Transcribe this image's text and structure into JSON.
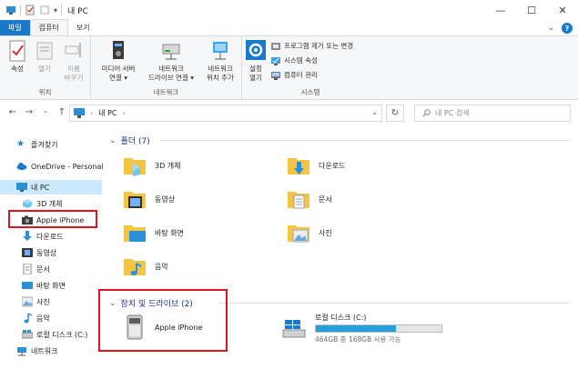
{
  "window": {
    "title": "내 PC",
    "controls": [
      "—",
      "☐",
      "✕"
    ]
  },
  "ribbon": {
    "tabs": [
      {
        "label": "파일"
      },
      {
        "label": "컴퓨터"
      },
      {
        "label": "보기"
      }
    ],
    "groups": {
      "location": {
        "label": "위치",
        "buttons": [
          {
            "label": "속성"
          },
          {
            "label": "열기"
          },
          {
            "label": "이름\n바꾸기"
          }
        ]
      },
      "network": {
        "label": "네트워크",
        "buttons": [
          {
            "label": "미디어 서버\n연결 ▾"
          },
          {
            "label": "네트워크\n드라이브 연결 ▾"
          },
          {
            "label": "네트워크\n위치 추가"
          }
        ]
      },
      "system": {
        "label": "시스템",
        "big_button": "설정\n열기",
        "small_buttons": [
          {
            "label": "프로그램 제거 또는 변경"
          },
          {
            "label": "시스템 속성"
          },
          {
            "label": "컴퓨터 관리"
          }
        ]
      }
    }
  },
  "address_bar": {
    "path": "내 PC",
    "search_placeholder": "내 PC 검색"
  },
  "nav_pane": {
    "items": [
      {
        "label": "즐겨찾기"
      },
      {
        "label": "OneDrive - Personal"
      },
      {
        "label": "내 PC"
      },
      {
        "label": "3D 개체"
      },
      {
        "label": "Apple iPhone"
      },
      {
        "label": "다운로드"
      },
      {
        "label": "동영상"
      },
      {
        "label": "문서"
      },
      {
        "label": "바탕 화면"
      },
      {
        "label": "사진"
      },
      {
        "label": "음악"
      },
      {
        "label": "로컬 디스크 (C:)"
      },
      {
        "label": "네트워크"
      }
    ]
  },
  "content": {
    "folders_header": "폴더 (7)",
    "folders": [
      {
        "label": "3D 개체"
      },
      {
        "label": "다운로드"
      },
      {
        "label": "동영상"
      },
      {
        "label": "문서"
      },
      {
        "label": "바탕 화면"
      },
      {
        "label": "사진"
      },
      {
        "label": "음악"
      }
    ],
    "devices_header": "장치 및 드라이브 (2)",
    "devices": [
      {
        "label": "Apple iPhone"
      },
      {
        "label": "로컬 디스크 (C:)",
        "space": "464GB 중 168GB 사용 가능",
        "used_fraction": 0.64
      }
    ]
  },
  "colors": {
    "accent": "#1979ca",
    "selection": "#cce8ff",
    "highlight_box": "#e0141e",
    "section_header": "#1e3287",
    "folder": "#f4c542"
  }
}
